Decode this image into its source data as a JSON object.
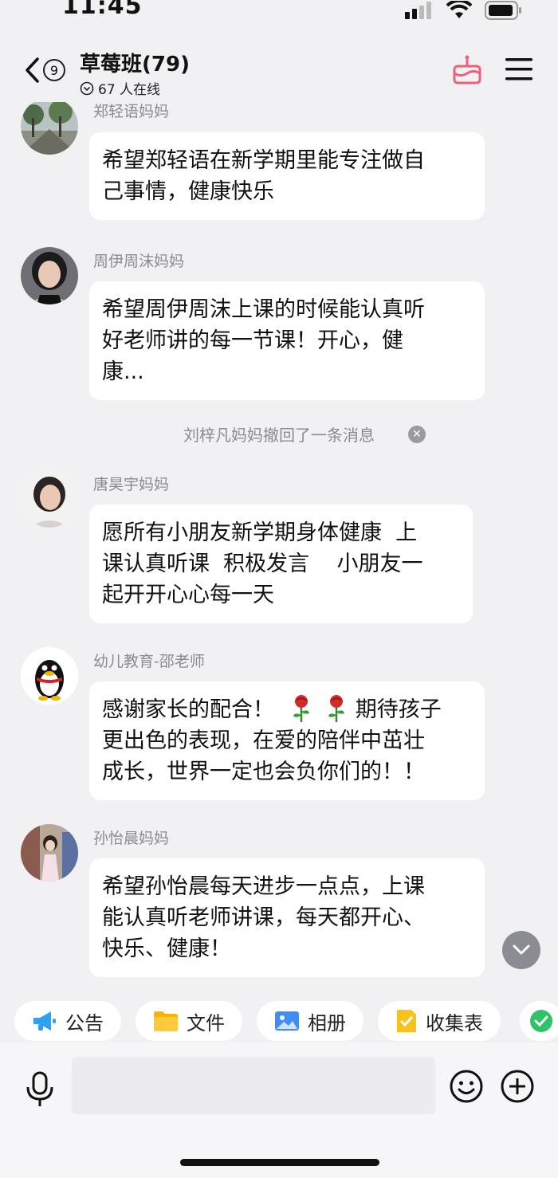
{
  "status_bar": {
    "time": "11:45"
  },
  "header": {
    "unread_count": "9",
    "title": "草莓班(79)",
    "online_status": "67 人在线"
  },
  "messages": [
    {
      "sender": "郑轻语妈妈",
      "lines": [
        "希望郑轻语在新学期里能专注做自",
        "己事情，健康快乐"
      ]
    },
    {
      "sender": "周伊周沫妈妈",
      "lines": [
        "希望周伊周沫上课的时候能认真听",
        "好老师讲的每一节课！开心，健",
        "康..."
      ]
    },
    {
      "sender": "唐昊宇妈妈",
      "lines": [
        "愿所有小朋友新学期身体健康  上",
        "课认真听课  积极发言    小朋友一",
        "起开开心心每一天"
      ]
    },
    {
      "sender": "幼儿教育-邵老师",
      "lines": [
        "感谢家长的配合！",
        "更出色的表现，在爱的陪伴中茁壮",
        "成长，世界一定也会负你们的！！"
      ],
      "line1_suffix": "期待孩子"
    },
    {
      "sender": "孙怡晨妈妈",
      "lines": [
        "希望孙怡晨每天进步一点点，上课",
        "能认真听老师讲课，每天都开心、",
        "快乐、健康！"
      ]
    }
  ],
  "system_notice": "刘梓凡妈妈撤回了一条消息",
  "quick_actions": [
    {
      "label": "公告",
      "icon": "megaphone-icon"
    },
    {
      "label": "文件",
      "icon": "folder-icon"
    },
    {
      "label": "相册",
      "icon": "photo-album-icon"
    },
    {
      "label": "收集表",
      "icon": "form-icon"
    }
  ],
  "colors": {
    "background": "#f1f1f4",
    "bubble": "#ffffff",
    "cake_icon": "#f0607a",
    "sender_text": "#8a8a90"
  }
}
